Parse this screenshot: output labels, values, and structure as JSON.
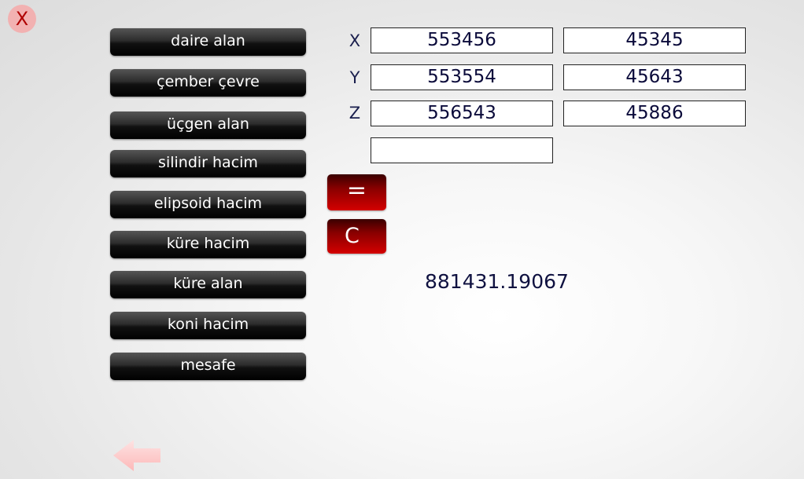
{
  "close": {
    "label": "X"
  },
  "buttons": [
    {
      "label": "daire alan"
    },
    {
      "label": "çember çevre"
    },
    {
      "label": "üçgen alan"
    },
    {
      "label": "silindir hacim"
    },
    {
      "label": "elipsoid hacim"
    },
    {
      "label": "küre hacim"
    },
    {
      "label": "küre alan"
    },
    {
      "label": "koni hacim"
    },
    {
      "label": "mesafe"
    }
  ],
  "axes": [
    "X",
    "Y",
    "Z"
  ],
  "inputs": {
    "x1": "553456",
    "x2": "45345",
    "y1": "553554",
    "y2": "45643",
    "z1": "556543",
    "z2": "45886",
    "extra": ""
  },
  "controls": {
    "equals": "=",
    "clear": "C"
  },
  "result": "881431.19067",
  "colors": {
    "button_dark": "#000000",
    "accent_red": "#d40000",
    "text_navy": "#1a1f4d"
  },
  "icons": {
    "close": "close-icon",
    "back": "back-arrow-icon"
  }
}
